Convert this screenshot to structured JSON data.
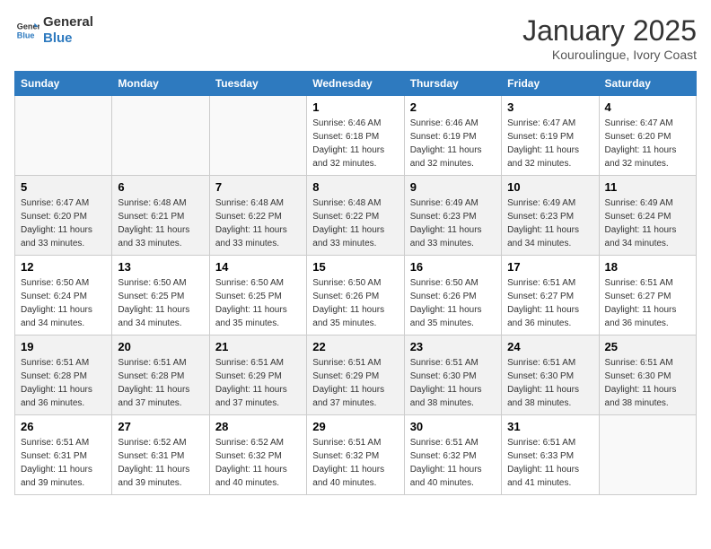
{
  "header": {
    "logo_line1": "General",
    "logo_line2": "Blue",
    "month_title": "January 2025",
    "location": "Kouroulingue, Ivory Coast"
  },
  "columns": [
    "Sunday",
    "Monday",
    "Tuesday",
    "Wednesday",
    "Thursday",
    "Friday",
    "Saturday"
  ],
  "weeks": [
    [
      {
        "day": "",
        "info": ""
      },
      {
        "day": "",
        "info": ""
      },
      {
        "day": "",
        "info": ""
      },
      {
        "day": "1",
        "info": "Sunrise: 6:46 AM\nSunset: 6:18 PM\nDaylight: 11 hours\nand 32 minutes."
      },
      {
        "day": "2",
        "info": "Sunrise: 6:46 AM\nSunset: 6:19 PM\nDaylight: 11 hours\nand 32 minutes."
      },
      {
        "day": "3",
        "info": "Sunrise: 6:47 AM\nSunset: 6:19 PM\nDaylight: 11 hours\nand 32 minutes."
      },
      {
        "day": "4",
        "info": "Sunrise: 6:47 AM\nSunset: 6:20 PM\nDaylight: 11 hours\nand 32 minutes."
      }
    ],
    [
      {
        "day": "5",
        "info": "Sunrise: 6:47 AM\nSunset: 6:20 PM\nDaylight: 11 hours\nand 33 minutes."
      },
      {
        "day": "6",
        "info": "Sunrise: 6:48 AM\nSunset: 6:21 PM\nDaylight: 11 hours\nand 33 minutes."
      },
      {
        "day": "7",
        "info": "Sunrise: 6:48 AM\nSunset: 6:22 PM\nDaylight: 11 hours\nand 33 minutes."
      },
      {
        "day": "8",
        "info": "Sunrise: 6:48 AM\nSunset: 6:22 PM\nDaylight: 11 hours\nand 33 minutes."
      },
      {
        "day": "9",
        "info": "Sunrise: 6:49 AM\nSunset: 6:23 PM\nDaylight: 11 hours\nand 33 minutes."
      },
      {
        "day": "10",
        "info": "Sunrise: 6:49 AM\nSunset: 6:23 PM\nDaylight: 11 hours\nand 34 minutes."
      },
      {
        "day": "11",
        "info": "Sunrise: 6:49 AM\nSunset: 6:24 PM\nDaylight: 11 hours\nand 34 minutes."
      }
    ],
    [
      {
        "day": "12",
        "info": "Sunrise: 6:50 AM\nSunset: 6:24 PM\nDaylight: 11 hours\nand 34 minutes."
      },
      {
        "day": "13",
        "info": "Sunrise: 6:50 AM\nSunset: 6:25 PM\nDaylight: 11 hours\nand 34 minutes."
      },
      {
        "day": "14",
        "info": "Sunrise: 6:50 AM\nSunset: 6:25 PM\nDaylight: 11 hours\nand 35 minutes."
      },
      {
        "day": "15",
        "info": "Sunrise: 6:50 AM\nSunset: 6:26 PM\nDaylight: 11 hours\nand 35 minutes."
      },
      {
        "day": "16",
        "info": "Sunrise: 6:50 AM\nSunset: 6:26 PM\nDaylight: 11 hours\nand 35 minutes."
      },
      {
        "day": "17",
        "info": "Sunrise: 6:51 AM\nSunset: 6:27 PM\nDaylight: 11 hours\nand 36 minutes."
      },
      {
        "day": "18",
        "info": "Sunrise: 6:51 AM\nSunset: 6:27 PM\nDaylight: 11 hours\nand 36 minutes."
      }
    ],
    [
      {
        "day": "19",
        "info": "Sunrise: 6:51 AM\nSunset: 6:28 PM\nDaylight: 11 hours\nand 36 minutes."
      },
      {
        "day": "20",
        "info": "Sunrise: 6:51 AM\nSunset: 6:28 PM\nDaylight: 11 hours\nand 37 minutes."
      },
      {
        "day": "21",
        "info": "Sunrise: 6:51 AM\nSunset: 6:29 PM\nDaylight: 11 hours\nand 37 minutes."
      },
      {
        "day": "22",
        "info": "Sunrise: 6:51 AM\nSunset: 6:29 PM\nDaylight: 11 hours\nand 37 minutes."
      },
      {
        "day": "23",
        "info": "Sunrise: 6:51 AM\nSunset: 6:30 PM\nDaylight: 11 hours\nand 38 minutes."
      },
      {
        "day": "24",
        "info": "Sunrise: 6:51 AM\nSunset: 6:30 PM\nDaylight: 11 hours\nand 38 minutes."
      },
      {
        "day": "25",
        "info": "Sunrise: 6:51 AM\nSunset: 6:30 PM\nDaylight: 11 hours\nand 38 minutes."
      }
    ],
    [
      {
        "day": "26",
        "info": "Sunrise: 6:51 AM\nSunset: 6:31 PM\nDaylight: 11 hours\nand 39 minutes."
      },
      {
        "day": "27",
        "info": "Sunrise: 6:52 AM\nSunset: 6:31 PM\nDaylight: 11 hours\nand 39 minutes."
      },
      {
        "day": "28",
        "info": "Sunrise: 6:52 AM\nSunset: 6:32 PM\nDaylight: 11 hours\nand 40 minutes."
      },
      {
        "day": "29",
        "info": "Sunrise: 6:51 AM\nSunset: 6:32 PM\nDaylight: 11 hours\nand 40 minutes."
      },
      {
        "day": "30",
        "info": "Sunrise: 6:51 AM\nSunset: 6:32 PM\nDaylight: 11 hours\nand 40 minutes."
      },
      {
        "day": "31",
        "info": "Sunrise: 6:51 AM\nSunset: 6:33 PM\nDaylight: 11 hours\nand 41 minutes."
      },
      {
        "day": "",
        "info": ""
      }
    ]
  ]
}
